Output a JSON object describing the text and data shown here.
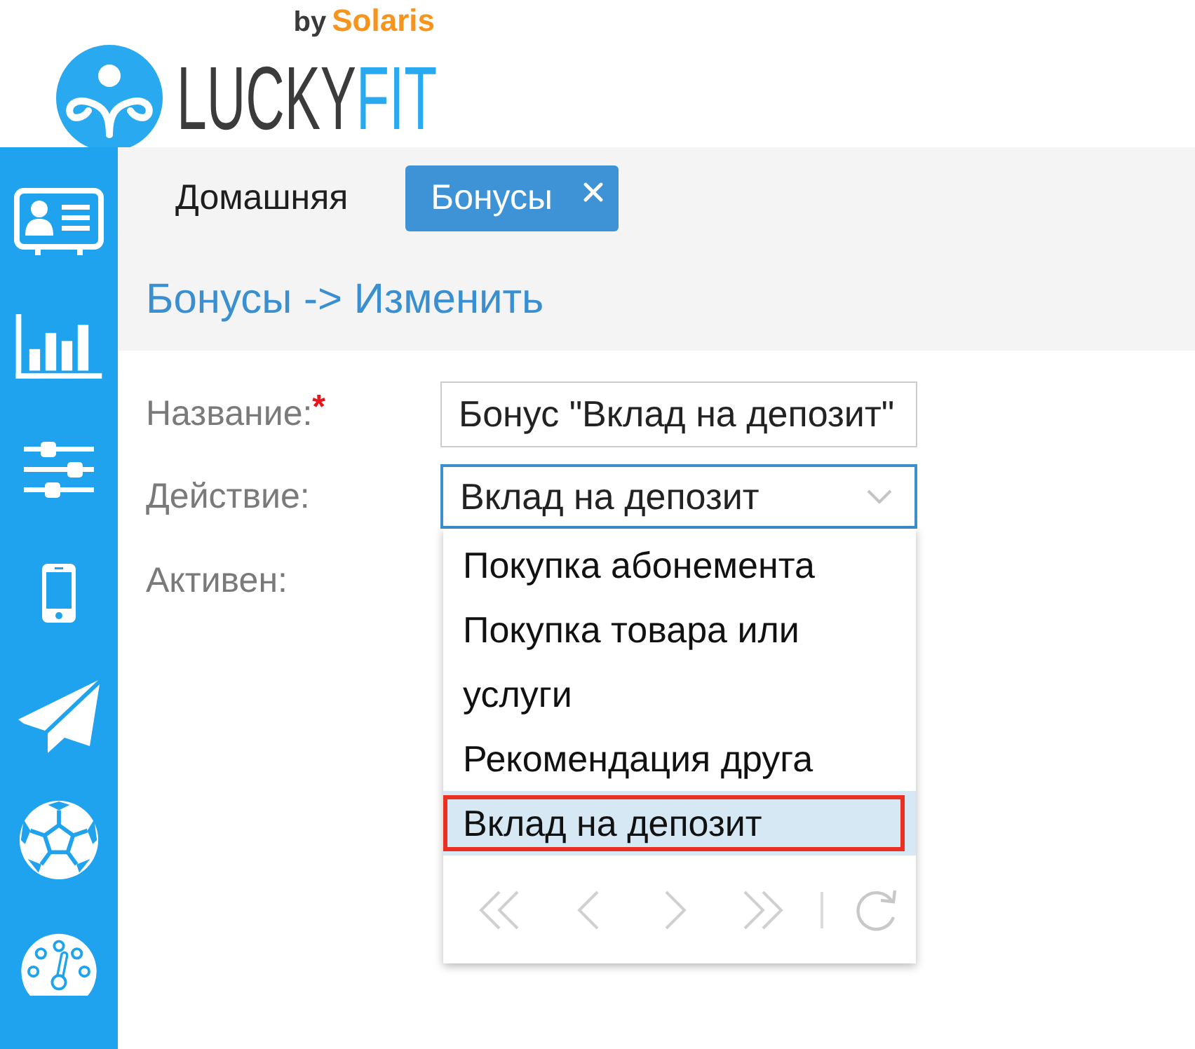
{
  "logo": {
    "prefix": "by",
    "maker": "Solaris",
    "name": "LUCKY",
    "name_accent": "FIT"
  },
  "tabs": [
    {
      "label": "Домашняя",
      "selected": false,
      "closable": false
    },
    {
      "label": "Бонусы",
      "selected": true,
      "closable": true
    }
  ],
  "breadcrumb": "Бонусы -> Изменить",
  "form": {
    "fields": [
      {
        "kind": "text",
        "label": "Название:",
        "required_mark": "*",
        "value": "Бонус \"Вклад на депозит\""
      },
      {
        "kind": "select",
        "label": "Действие:",
        "value": "Вклад на депозит",
        "focused": true,
        "expanded": true,
        "options": [
          {
            "label": "Покупка абонемента",
            "selected": false,
            "highlighted": false
          },
          {
            "label": "Покупка товара или услуги",
            "selected": false,
            "highlighted": false
          },
          {
            "label": "Рекомендация друга",
            "selected": false,
            "highlighted": false
          },
          {
            "label": "Вклад на депозит",
            "selected": true,
            "highlighted": true
          }
        ]
      },
      {
        "label": "Активен:"
      }
    ]
  }
}
